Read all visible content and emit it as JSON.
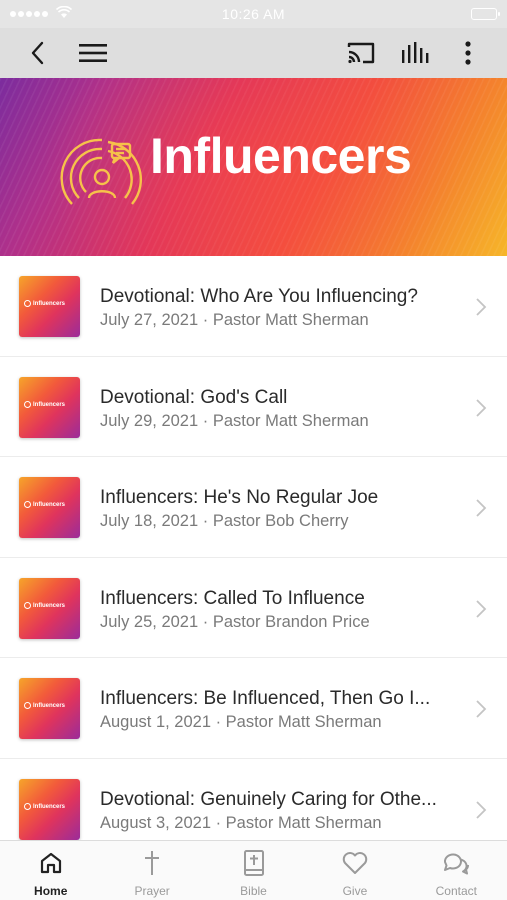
{
  "status_bar": {
    "time": "10:26 AM"
  },
  "toolbar": {
    "back_icon": "chevron-left-icon",
    "menu_icon": "hamburger-icon",
    "cast_icon": "cast-icon",
    "audio_icon": "audio-bars-icon",
    "more_icon": "more-vertical-icon"
  },
  "banner": {
    "title": "Influencers"
  },
  "items": [
    {
      "title": "Devotional: Who Are You Influencing?",
      "subtitle": "July 27, 2021 · Pastor Matt Sherman",
      "thumb_text": "Influencers"
    },
    {
      "title": "Devotional: God's Call",
      "subtitle": "July 29, 2021 · Pastor Matt Sherman",
      "thumb_text": "Influencers"
    },
    {
      "title": "Influencers: He's No Regular Joe",
      "subtitle": "July 18, 2021 · Pastor Bob Cherry",
      "thumb_text": "Influencers"
    },
    {
      "title": "Influencers: Called To Influence",
      "subtitle": "July 25, 2021 · Pastor Brandon Price",
      "thumb_text": "Influencers"
    },
    {
      "title": "Influencers: Be Influenced, Then Go I...",
      "subtitle": "August 1, 2021 · Pastor Matt Sherman",
      "thumb_text": "Influencers"
    },
    {
      "title": "Devotional: Genuinely Caring for Othe...",
      "subtitle": "August 3, 2021 · Pastor Matt Sherman",
      "thumb_text": "Influencers"
    }
  ],
  "tabs": [
    {
      "label": "Home",
      "icon": "home-icon",
      "active": true
    },
    {
      "label": "Prayer",
      "icon": "cross-icon",
      "active": false
    },
    {
      "label": "Bible",
      "icon": "bible-icon",
      "active": false
    },
    {
      "label": "Give",
      "icon": "heart-icon",
      "active": false
    },
    {
      "label": "Contact",
      "icon": "chat-bubbles-icon",
      "active": false
    }
  ],
  "colors": {
    "active_tab": "#222222",
    "inactive_tab": "#9a9a9a",
    "toolbar": "#dedede"
  }
}
